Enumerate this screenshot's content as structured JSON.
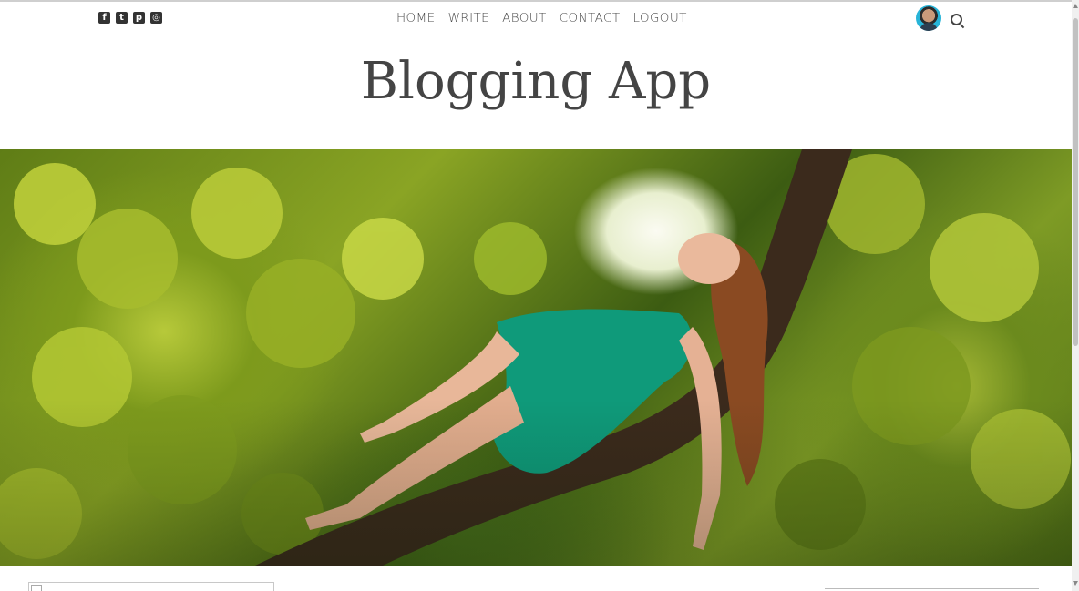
{
  "social": [
    {
      "icon": "facebook-square-icon",
      "glyph": "f"
    },
    {
      "icon": "twitter-square-icon",
      "glyph": "t"
    },
    {
      "icon": "pinterest-square-icon",
      "glyph": "p"
    },
    {
      "icon": "instagram-icon",
      "glyph": "◎"
    }
  ],
  "nav": {
    "items": [
      "HOME",
      "WRITE",
      "ABOUT",
      "CONTACT",
      "LOGOUT"
    ]
  },
  "header": {
    "title": "Blogging App"
  },
  "colors": {
    "text": "#444444",
    "nav_text": "#4a4a4a",
    "avatar_ring": "#27b4d8"
  }
}
